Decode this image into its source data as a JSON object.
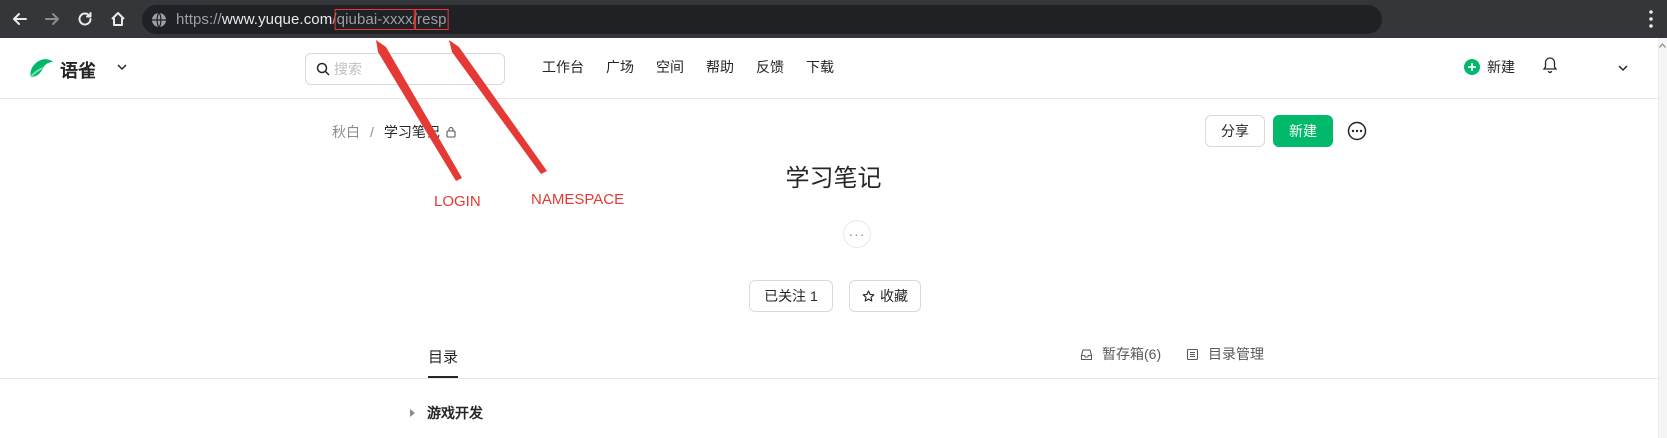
{
  "browser": {
    "url_prefix": "https://",
    "url_host": "www.yuque.com",
    "url_slash": "/",
    "url_login": "qiubai-xxxx",
    "url_slash2": "/",
    "url_namespace": "resp",
    "icons": [
      "back-arrow-icon",
      "forward-arrow-icon",
      "reload-icon",
      "home-icon",
      "globe-icon",
      "kebab-menu-icon"
    ]
  },
  "header": {
    "brand": "语雀",
    "search_placeholder": "搜索",
    "nav": [
      "工作台",
      "广场",
      "空间",
      "帮助",
      "反馈",
      "下载"
    ],
    "new_label": "新建",
    "accent": "#00b96b"
  },
  "breadcrumb": {
    "owner": "秋白",
    "separator": "/",
    "book": "学习笔记"
  },
  "actions": {
    "share": "分享",
    "create": "新建"
  },
  "book": {
    "title": "学习笔记",
    "desc_more": "···",
    "follow": "已关注 1",
    "collect": "收藏"
  },
  "tabs": {
    "toc": "目录",
    "drafts": "暂存箱(6)",
    "toc_manage": "目录管理"
  },
  "toc_items": [
    "游戏开发"
  ],
  "annotations": {
    "login": "LOGIN",
    "namespace": "NAMESPACE",
    "color": "#e53935"
  }
}
